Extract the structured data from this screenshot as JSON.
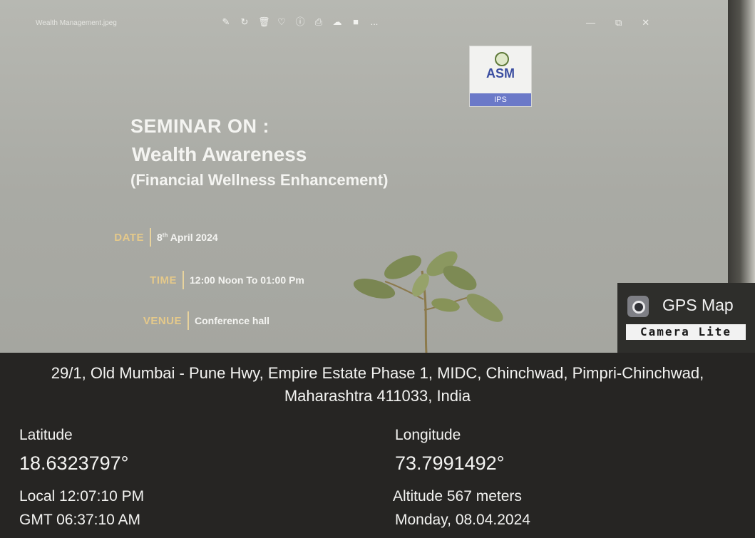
{
  "window": {
    "title": "Wealth Management.jpeg",
    "toolbar_icons": [
      "edit-icon",
      "rotate-icon",
      "delete-icon",
      "heart-icon",
      "info-icon",
      "print-icon",
      "cloud-icon",
      "folder-icon",
      "more-icon"
    ],
    "more_label": "...",
    "controls": [
      "minimize-icon",
      "restore-icon",
      "close-icon"
    ]
  },
  "slide": {
    "logo_text": "ASM",
    "logo_band": "IPS",
    "heading": "SEMINAR ON :",
    "title": "Wealth Awareness",
    "subtitle": "(Financial Wellness Enhancement)",
    "date_label": "DATE",
    "date_day": "8",
    "date_suffix": "th",
    "date_rest": " April 2024",
    "time_label": "TIME",
    "time_value": "12:00 Noon To 01:00 Pm",
    "venue_label": "VENUE",
    "venue_value": "Conference hall"
  },
  "gps_badge": {
    "name": "GPS Map",
    "sub": "Camera Lite"
  },
  "gps_panel": {
    "address_line1": "29/1, Old Mumbai - Pune Hwy, Empire Estate Phase 1, MIDC, Chinchwad, Pimpri-Chinchwad,",
    "address_line2": "Maharashtra 411033, India",
    "latitude_label": "Latitude",
    "latitude_value": "18.6323797°",
    "longitude_label": "Longitude",
    "longitude_value": "73.7991492°",
    "local_time": "Local 12:07:10 PM",
    "gmt_time": "GMT 06:37:10 AM",
    "altitude": "Altitude 567 meters",
    "date": "Monday, 08.04.2024"
  },
  "colors": {
    "panel_bg": "#262523",
    "label_gold": "#e5c98a",
    "logo_blue": "#6b79c8"
  }
}
